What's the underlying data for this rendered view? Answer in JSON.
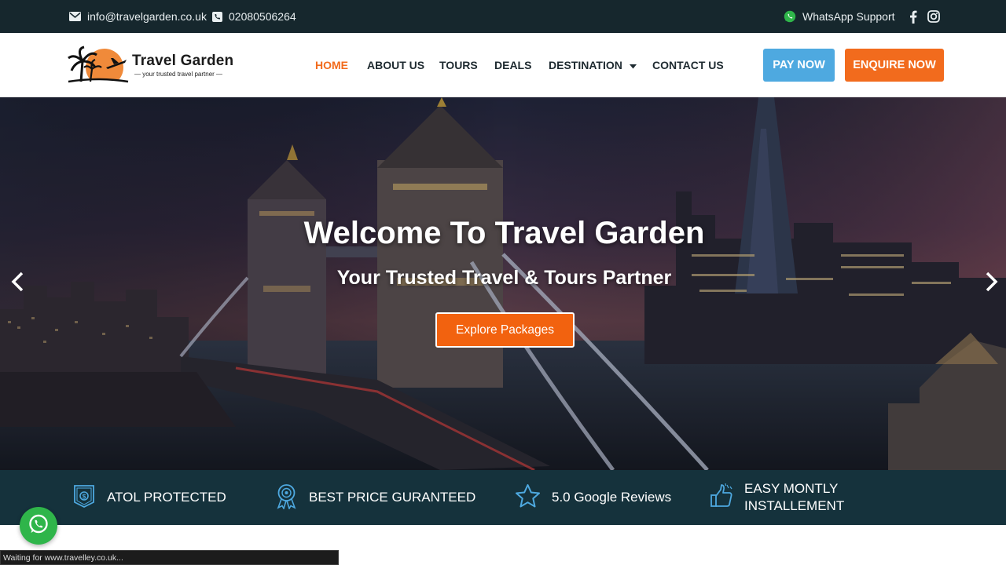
{
  "topbar": {
    "email": "info@travelgarden.co.uk",
    "phone": "02080506264",
    "whatsapp_label": "WhatsApp Support",
    "social_icons": [
      "facebook-icon",
      "instagram-icon"
    ]
  },
  "brand": {
    "name": "Travel Garden",
    "tagline": "— your trusted travel partner —"
  },
  "nav": {
    "items": [
      {
        "label": "HOME",
        "active": true
      },
      {
        "label": "ABOUT US",
        "active": false
      },
      {
        "label": "TOURS",
        "active": false
      },
      {
        "label": "DEALS",
        "active": false
      },
      {
        "label": "DESTINATION",
        "active": false,
        "has_dropdown": true
      },
      {
        "label": "CONTACT US",
        "active": false
      }
    ],
    "pay_now": "PAY NOW",
    "enquire_now": "ENQUIRE NOW"
  },
  "hero": {
    "title": "Welcome To Travel Garden",
    "subtitle": "Your Trusted Travel & Tours Partner",
    "cta": "Explore Packages",
    "prev_icon": "chevron-left-icon",
    "next_icon": "chevron-right-icon"
  },
  "features": [
    {
      "icon": "shield-icon",
      "label": "ATOL PROTECTED"
    },
    {
      "icon": "award-ribbon-icon",
      "label": "BEST PRICE GURANTEED"
    },
    {
      "icon": "star-icon",
      "label": "5.0 Google Reviews"
    },
    {
      "icon": "thumbs-up-icon",
      "label_line1": "EASY MONTLY",
      "label_line2": "INSTALLEMENT"
    }
  ],
  "status_bar": {
    "text": "Waiting for www.travelley.co.uk..."
  },
  "colors": {
    "accent": "#f26b1d",
    "pay_button": "#4ea9e0",
    "topbar_bg": "#16272d",
    "features_bg": "#15323c",
    "whatsapp": "#2fb54a"
  }
}
